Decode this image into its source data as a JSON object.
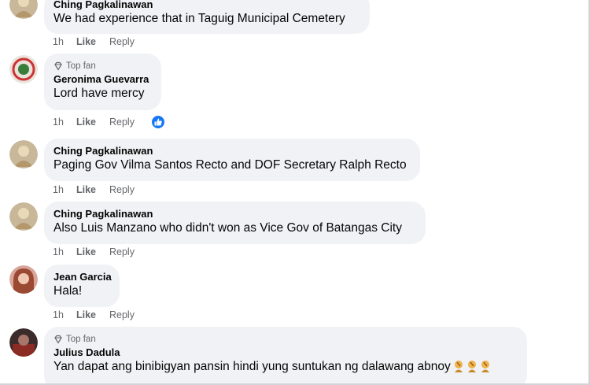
{
  "comments": [
    {
      "author": "Ching Pagkalinawan",
      "text": "We had experience that in Taguig Municipal Cemetery",
      "time": "1h",
      "like": "Like",
      "reply": "Reply",
      "top_fan": false
    },
    {
      "author": "Geronima Guevarra",
      "text": "Lord have mercy",
      "time": "1h",
      "like": "Like",
      "reply": "Reply",
      "top_fan": true,
      "badge": "Top fan",
      "reaction_icon": "like-reaction-icon"
    },
    {
      "author": "Ching Pagkalinawan",
      "text": "Paging Gov Vilma Santos Recto and DOF Secretary Ralph Recto",
      "time": "1h",
      "like": "Like",
      "reply": "Reply",
      "top_fan": false
    },
    {
      "author": "Ching Pagkalinawan",
      "text": "Also Luis Manzano who didn't won as Vice Gov of Batangas City",
      "time": "1h",
      "like": "Like",
      "reply": "Reply",
      "top_fan": false
    },
    {
      "author": "Jean Garcia",
      "text": "Hala!",
      "time": "1h",
      "like": "Like",
      "reply": "Reply",
      "top_fan": false
    },
    {
      "author": "Julius Dadula",
      "text": "Yan dapat ang binibigyan pansin hindi yung suntukan ng dalawang abnoy",
      "time": "",
      "like": "",
      "reply": "",
      "top_fan": true,
      "badge": "Top fan",
      "emoji_icon": "person-facepalm-emoji-icon",
      "emoji_count": 3
    }
  ],
  "colors": {
    "bubble": "#f0f2f5",
    "secondary_text": "#65676b",
    "reaction_blue": "#1877f2"
  }
}
